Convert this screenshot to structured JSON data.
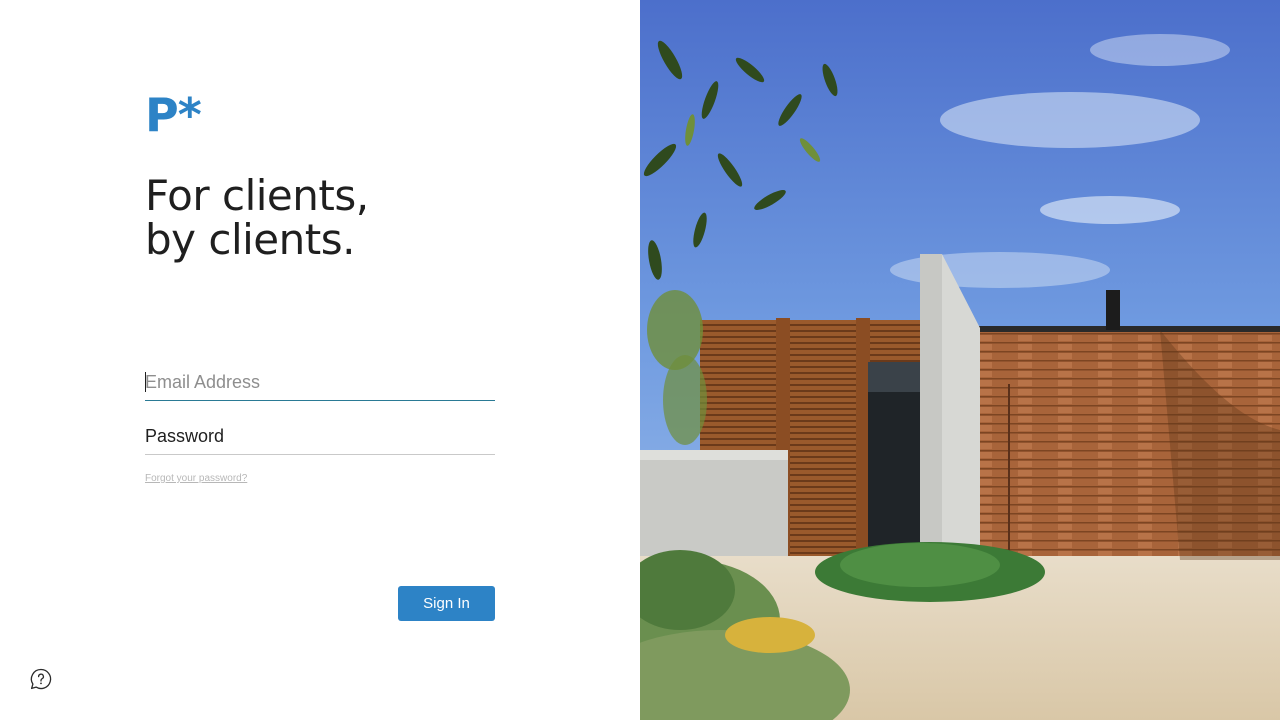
{
  "brand": {
    "logo_text": "P*",
    "accent_color": "#2d83c6"
  },
  "tagline": {
    "line1": "For clients,",
    "line2": "by clients."
  },
  "login_form": {
    "email": {
      "placeholder": "Email Address",
      "value": ""
    },
    "password": {
      "placeholder": "Password",
      "value": ""
    },
    "forgot_link": "Forgot your password?",
    "submit_label": "Sign In"
  },
  "help": {
    "icon": "help-chat-icon"
  },
  "hero_image": {
    "subject": "house-exterior-photo"
  }
}
